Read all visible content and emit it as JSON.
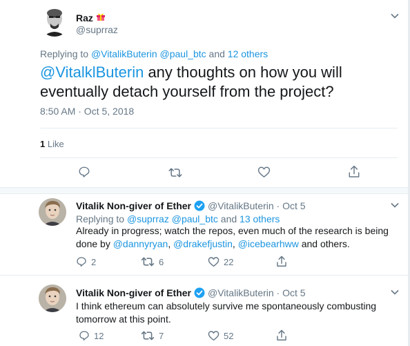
{
  "main": {
    "name": "Raz",
    "gift_icon": "gift-icon",
    "handle": "@suprraz",
    "replying_prefix": "Replying to ",
    "replying_mention1": "@VitalikButerin",
    "replying_mention2": "@paul_btc",
    "replying_and": "and",
    "replying_others": "12 others",
    "mention": "@VitalklButerin",
    "text": " any thoughts on how you will eventually detach yourself from the project?",
    "time": "8:50 AM · Oct 5, 2018",
    "likes_count": "1",
    "likes_label": "Like"
  },
  "replies": [
    {
      "name": "Vitalik Non-giver of Ether",
      "handle": "@VitalikButerin · Oct 5",
      "replying_prefix": "Replying to ",
      "replying_mention1": "@suprraz",
      "replying_mention2": "@paul_btc",
      "replying_and": "and",
      "replying_others": "13 others",
      "text_part1": "Already in progress; watch the repos, even much of the research is being done by ",
      "mention_a": "@dannyryan",
      "comma1": ", ",
      "mention_b": "@drakefjustin",
      "comma2": ", ",
      "mention_c": "@icebearhww",
      "text_part2": " and others.",
      "reply_count": "2",
      "retweet_count": "6",
      "like_count": "22"
    },
    {
      "name": "Vitalik Non-giver of Ether",
      "handle": "@VitalikButerin · Oct 5",
      "text": "I think ethereum can absolutely survive me spontaneously combusting tomorrow at this point.",
      "reply_count": "12",
      "retweet_count": "7",
      "like_count": "52"
    }
  ],
  "colors": {
    "link": "#1b95e0",
    "secondary_text": "#657786",
    "primary_text": "#14171a",
    "verified": "#1da1f2"
  }
}
